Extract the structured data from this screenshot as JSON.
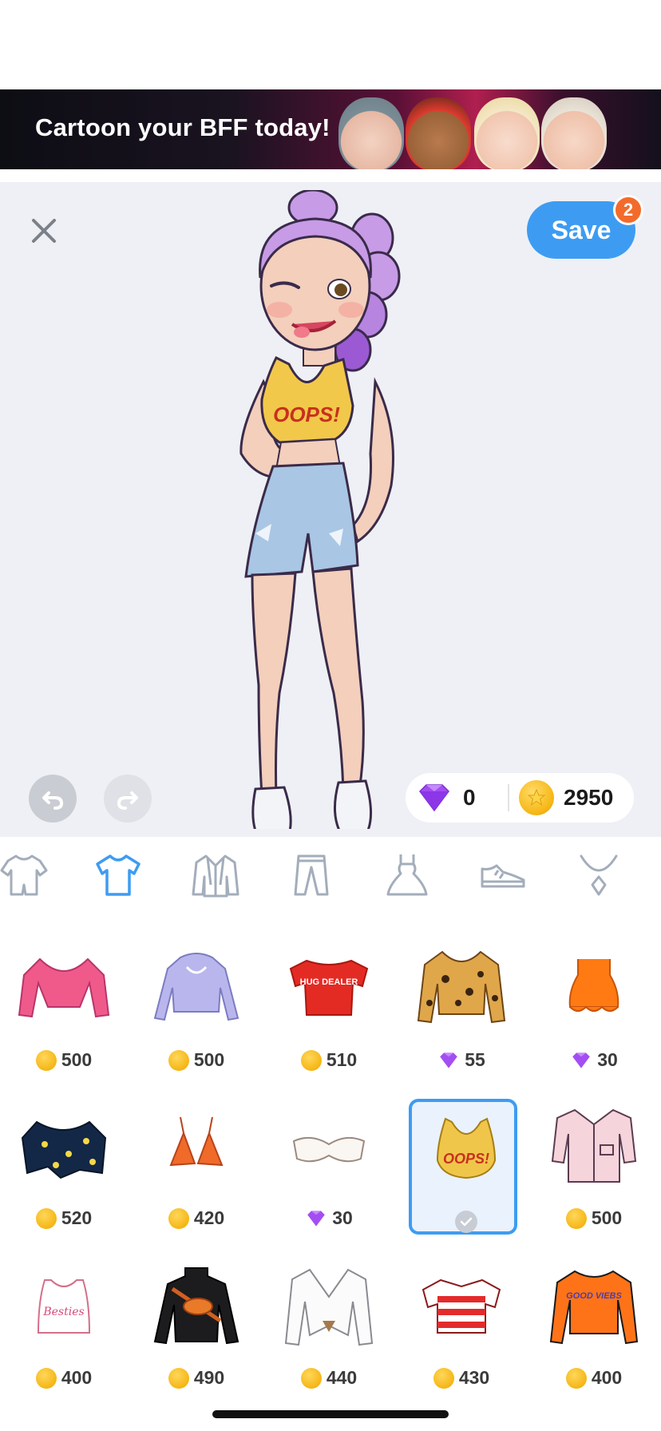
{
  "banner": {
    "text": "Cartoon your BFF today!"
  },
  "editor": {
    "close_icon": "close-icon",
    "save_label": "Save",
    "save_badge": "2",
    "undo_icon": "undo-icon",
    "redo_icon": "redo-icon",
    "top_text": "OOPS!"
  },
  "currency": {
    "gems": "0",
    "coins": "2950"
  },
  "tabs": [
    {
      "name": "onesie",
      "icon": "onesie-icon"
    },
    {
      "name": "tops",
      "icon": "tshirt-icon",
      "active": true
    },
    {
      "name": "jackets",
      "icon": "jacket-icon"
    },
    {
      "name": "pants",
      "icon": "pants-icon"
    },
    {
      "name": "dresses",
      "icon": "dress-icon"
    },
    {
      "name": "shoes",
      "icon": "sneaker-icon"
    },
    {
      "name": "accessories",
      "icon": "necklace-icon"
    }
  ],
  "items": [
    {
      "price": "500",
      "currency": "coin"
    },
    {
      "price": "500",
      "currency": "coin"
    },
    {
      "price": "510",
      "currency": "coin",
      "label": "HUG DEALER"
    },
    {
      "price": "55",
      "currency": "gem"
    },
    {
      "price": "30",
      "currency": "gem"
    },
    {
      "price": "520",
      "currency": "coin"
    },
    {
      "price": "420",
      "currency": "coin"
    },
    {
      "price": "30",
      "currency": "gem"
    },
    {
      "price": "",
      "currency": "owned",
      "label": "OOPS!"
    },
    {
      "price": "500",
      "currency": "coin"
    },
    {
      "price": "400",
      "currency": "coin",
      "label": "Besties"
    },
    {
      "price": "490",
      "currency": "coin"
    },
    {
      "price": "440",
      "currency": "coin"
    },
    {
      "price": "430",
      "currency": "coin"
    },
    {
      "price": "400",
      "currency": "coin",
      "label": "GOOD VIEBS"
    }
  ],
  "colors": {
    "accent": "#3d9cf2",
    "badge": "#f36b2b",
    "gem": "#9b3ff0",
    "coin": "#f5b616"
  }
}
